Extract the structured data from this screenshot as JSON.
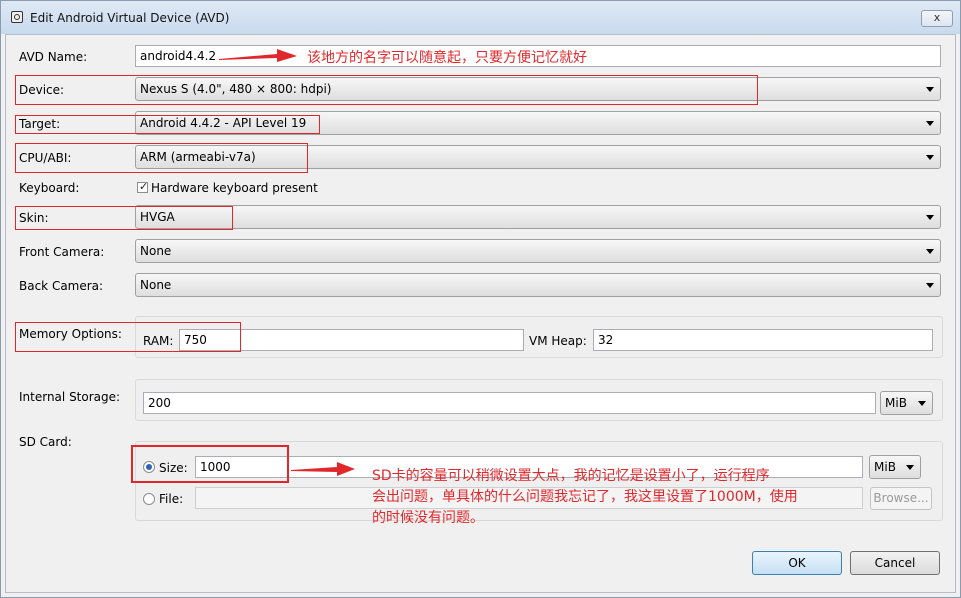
{
  "window": {
    "title": "Edit Android Virtual Device (AVD)",
    "close_label": "x"
  },
  "fields": {
    "avd_name": {
      "label": "AVD Name:",
      "value": "android4.4.2"
    },
    "device": {
      "label": "Device:",
      "value": "Nexus S (4.0\", 480 × 800: hdpi)"
    },
    "target": {
      "label": "Target:",
      "value": "Android 4.4.2 - API Level 19"
    },
    "cpu_abi": {
      "label": "CPU/ABI:",
      "value": "ARM (armeabi-v7a)"
    },
    "keyboard": {
      "label": "Keyboard:",
      "checkbox_label": "Hardware keyboard present",
      "checked": true
    },
    "skin": {
      "label": "Skin:",
      "value": "HVGA"
    },
    "front_camera": {
      "label": "Front Camera:",
      "value": "None"
    },
    "back_camera": {
      "label": "Back Camera:",
      "value": "None"
    },
    "memory": {
      "label": "Memory Options:",
      "ram_label": "RAM:",
      "ram_value": "750",
      "vm_heap_label": "VM Heap:",
      "vm_heap_value": "32"
    },
    "internal_storage": {
      "label": "Internal Storage:",
      "value": "200",
      "unit": "MiB"
    },
    "sd_card": {
      "label": "SD Card:",
      "size_label": "Size:",
      "size_value": "1000",
      "size_unit": "MiB",
      "size_selected": true,
      "file_label": "File:",
      "file_value": "",
      "browse_label": "Browse..."
    }
  },
  "buttons": {
    "ok": "OK",
    "cancel": "Cancel"
  },
  "annotations": {
    "name_note": "该地方的名字可以随意起，只要方便记忆就好",
    "sd_note_line1": "SD卡的容量可以稍微设置大点，我的记忆是设置小了，运行程序",
    "sd_note_line2": "会出问题，单具体的什么问题我忘记了，我这里设置了1000M，使用",
    "sd_note_line3": "的时候没有问题。"
  },
  "colors": {
    "annotation_red": "#e0282c",
    "title_gradient_top": "#dfe9f5",
    "title_gradient_bottom": "#c9daee"
  }
}
